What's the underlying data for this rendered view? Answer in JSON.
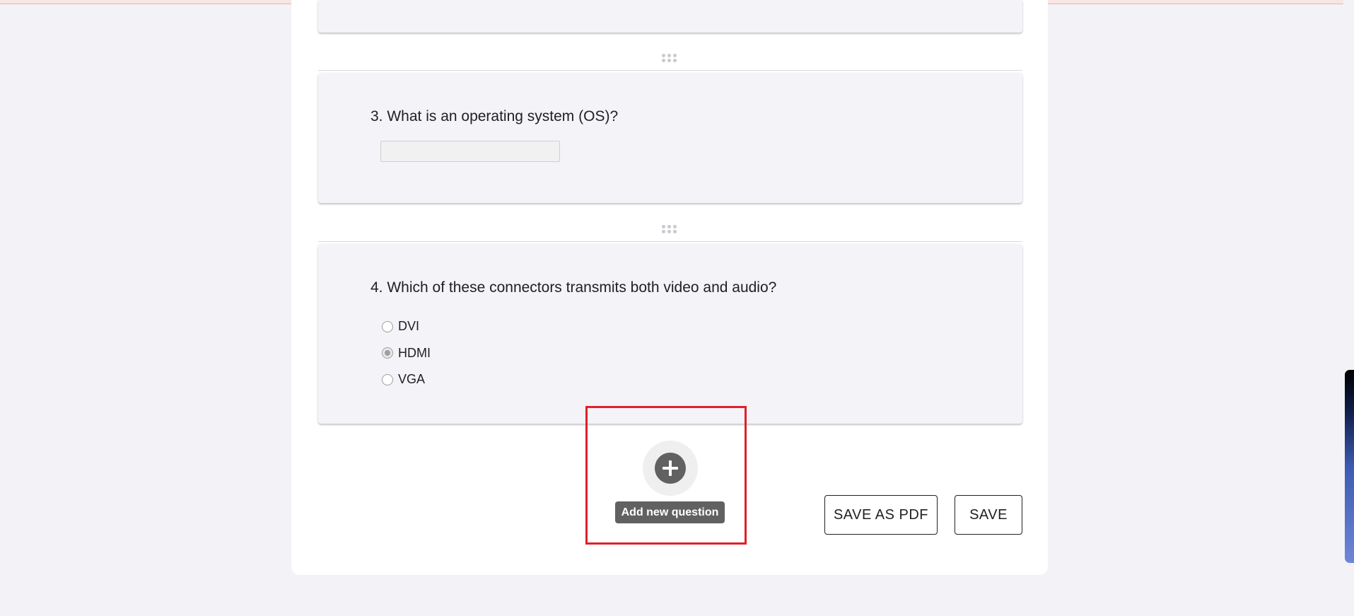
{
  "questions": [
    {
      "title": "3. What is an operating system (OS)?",
      "answer_value": ""
    },
    {
      "title": "4. Which of these connectors transmits both video and audio?",
      "options": [
        {
          "label": "DVI",
          "selected": false
        },
        {
          "label": "HDMI",
          "selected": true
        },
        {
          "label": "VGA",
          "selected": false
        }
      ]
    }
  ],
  "add_question": {
    "icon": "plus-circle-icon",
    "tooltip": "Add new question"
  },
  "actions": {
    "save_pdf_label": "SAVE AS PDF",
    "save_label": "SAVE"
  },
  "colors": {
    "highlight": "#e0202a",
    "card_bg": "#f4f3f8",
    "page_bg": "#f3f2f7",
    "tooltip_bg": "#616161"
  }
}
